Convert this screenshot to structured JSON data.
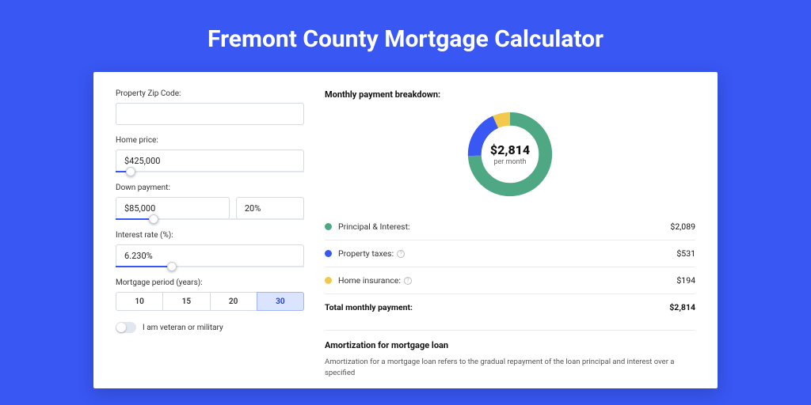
{
  "title": "Fremont County Mortgage Calculator",
  "form": {
    "zip": {
      "label": "Property Zip Code:",
      "value": ""
    },
    "home_price": {
      "label": "Home price:",
      "value": "$425,000",
      "slider_pct": 8
    },
    "down_payment": {
      "label": "Down payment:",
      "value": "$85,000",
      "pct_value": "20%",
      "slider_pct": 20
    },
    "interest": {
      "label": "Interest rate (%):",
      "value": "6.230%",
      "slider_pct": 30
    },
    "period": {
      "label": "Mortgage period (years):",
      "options": [
        "10",
        "15",
        "20",
        "30"
      ],
      "selected": "30"
    },
    "veteran_label": "I am veteran or military"
  },
  "breakdown": {
    "title": "Monthly payment breakdown:",
    "center_amount": "$2,814",
    "center_sub": "per month",
    "rows": [
      {
        "dot": "g",
        "label": "Principal & Interest:",
        "value": "$2,089",
        "info": false
      },
      {
        "dot": "b",
        "label": "Property taxes:",
        "value": "$531",
        "info": true
      },
      {
        "dot": "y",
        "label": "Home insurance:",
        "value": "$194",
        "info": true
      }
    ],
    "total_label": "Total monthly payment:",
    "total_value": "$2,814"
  },
  "amortization": {
    "title": "Amortization for mortgage loan",
    "text": "Amortization for a mortgage loan refers to the gradual repayment of the loan principal and interest over a specified"
  },
  "chart_data": {
    "type": "pie",
    "title": "Monthly payment breakdown",
    "series": [
      {
        "name": "Principal & Interest",
        "value": 2089,
        "color": "#4fa884"
      },
      {
        "name": "Property taxes",
        "value": 531,
        "color": "#3857f3"
      },
      {
        "name": "Home insurance",
        "value": 194,
        "color": "#f2c94c"
      }
    ],
    "total": 2814,
    "unit": "USD per month"
  }
}
